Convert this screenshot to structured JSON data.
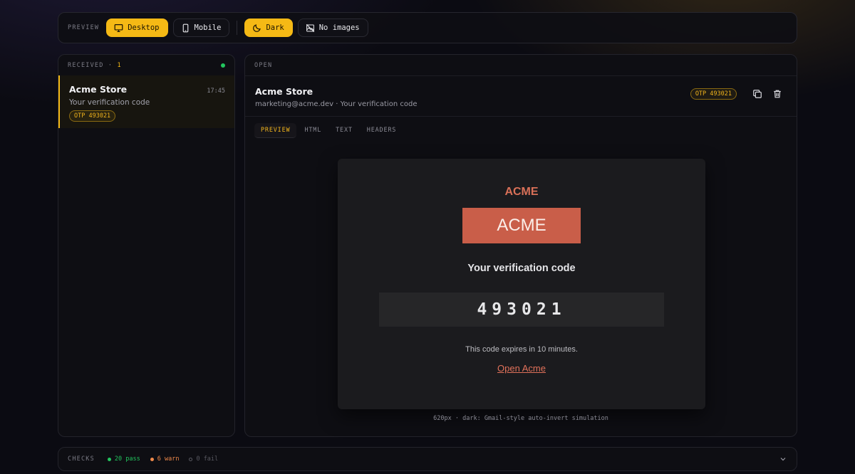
{
  "toolbar": {
    "label": "PREVIEW",
    "buttons": [
      {
        "label": "Desktop",
        "icon": "monitor-icon",
        "active": true
      },
      {
        "label": "Mobile",
        "icon": "phone-icon",
        "active": false
      },
      {
        "label": "Dark",
        "icon": "moon-icon",
        "active": true
      },
      {
        "label": "No images",
        "icon": "image-off-icon",
        "active": false
      }
    ]
  },
  "inbox": {
    "label": "RECEIVED",
    "separator": "·",
    "count": "1",
    "status_color": "#22c55e",
    "items": [
      {
        "from": "Acme Store",
        "time": "17:45",
        "subject": "Your verification code",
        "badge": "OTP 493021"
      }
    ]
  },
  "open": {
    "label": "OPEN",
    "from": "Acme Store",
    "meta": "marketing@acme.dev · Your verification code",
    "badge": "OTP 493021",
    "tabs": [
      "PREVIEW",
      "HTML",
      "TEXT",
      "HEADERS"
    ],
    "active_tab": "PREVIEW"
  },
  "email": {
    "brand": "ACME",
    "logo_text": "ACME",
    "heading": "Your verification code",
    "code": "493021",
    "expiry": "This code expires in 10 minutes.",
    "link": "Open Acme",
    "accent": "#c95e49"
  },
  "caption": "620px · dark: Gmail-style auto-invert simulation",
  "checks": {
    "label": "CHECKS",
    "pass": "20 pass",
    "warn": "6 warn",
    "fail": "0 fail",
    "colors": {
      "pass": "#22c55e",
      "warn": "#f08a4b",
      "fail": "#5a5a62"
    }
  },
  "theme": {
    "accent": "#f5b915"
  }
}
